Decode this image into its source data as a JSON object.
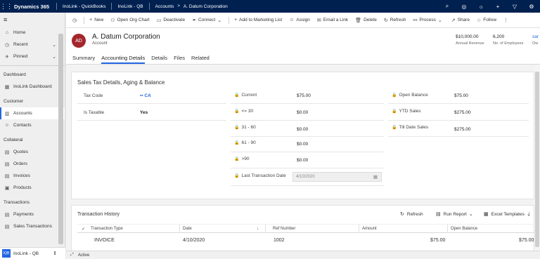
{
  "topbar": {
    "app_name": "Dynamics 365",
    "crumbs": [
      "InoLink - QuickBooks",
      "InoLink - QB",
      "Accounts",
      "A. Datum Corporation"
    ]
  },
  "sidebar": {
    "home": "Home",
    "recent": "Recent",
    "pinned": "Pinned",
    "group_dashboard": "Dashboard",
    "inolink_dashboard": "InoLink Dashboard",
    "group_customer": "Customer",
    "accounts": "Accounts",
    "contacts": "Contacts",
    "group_collateral": "Collateral",
    "quotes": "Quotes",
    "orders": "Orders",
    "invoices": "Invoices",
    "products": "Products",
    "group_transactions": "Transactions",
    "payments": "Payments",
    "sales_transactions": "Sales Transactions",
    "area_badge": "IQB",
    "area_label": "InoLink - QB"
  },
  "commands": {
    "new": "New",
    "open_org_chart": "Open Org Chart",
    "deactivate": "Deactivate",
    "connect": "Connect",
    "add_to_marketing_list": "Add to Marketing List",
    "assign": "Assign",
    "email_link": "Email a Link",
    "delete": "Delete",
    "refresh": "Refresh",
    "process": "Process",
    "share": "Share",
    "follow": "Follow"
  },
  "record": {
    "initials": "AD",
    "name": "A. Datum Corporation",
    "entity": "Account",
    "annual_revenue": "$10,000.00",
    "annual_revenue_label": "Annual Revenue",
    "employees": "6,200",
    "employees_label": "No. of Employees",
    "owner_value": "sar",
    "owner_label": "Ow"
  },
  "tabs": [
    "Summary",
    "Accounting Details",
    "Details",
    "Files",
    "Related"
  ],
  "active_tab": "Accounting Details",
  "section": {
    "title": "Sales Tax Details, Aging & Balance",
    "tax_code_label": "Tax Code",
    "tax_code_value": "CA",
    "is_taxable_label": "Is Taxable",
    "is_taxable_value": "Yes",
    "current_label": "Current",
    "current_value": "$75.00",
    "le30_label": "<= 30",
    "le30_value": "$0.00",
    "d31_60_label": "31 - 60",
    "d31_60_value": "$0.00",
    "d61_90_label": "61 - 90",
    "d61_90_value": "$0.00",
    "gt90_label": ">90",
    "gt90_value": "$0.00",
    "last_txn_label": "Last Transaction Date",
    "last_txn_value": "4/10/2020",
    "open_balance_label": "Open Balance",
    "open_balance_value": "$75.00",
    "ytd_sales_label": "YTD Sales",
    "ytd_sales_value": "$275.00",
    "till_date_label": "Till Date Sales",
    "till_date_value": "$275.00"
  },
  "txn_history": {
    "title": "Transaction History",
    "refresh": "Refresh",
    "run_report": "Run Report",
    "excel_templates": "Excel Templates",
    "columns": [
      "Transaction Type",
      "Date",
      "Ref Number",
      "Amount",
      "Open Balance"
    ],
    "row": {
      "type": "INVOICE",
      "date": "4/10/2020",
      "ref": "1002",
      "amount": "$75.00",
      "open_balance": "$75.00"
    }
  },
  "status": {
    "text": "Active"
  },
  "colors": {
    "topbar": "#002050",
    "accent": "#2266e3",
    "avatar": "#a4262c"
  }
}
